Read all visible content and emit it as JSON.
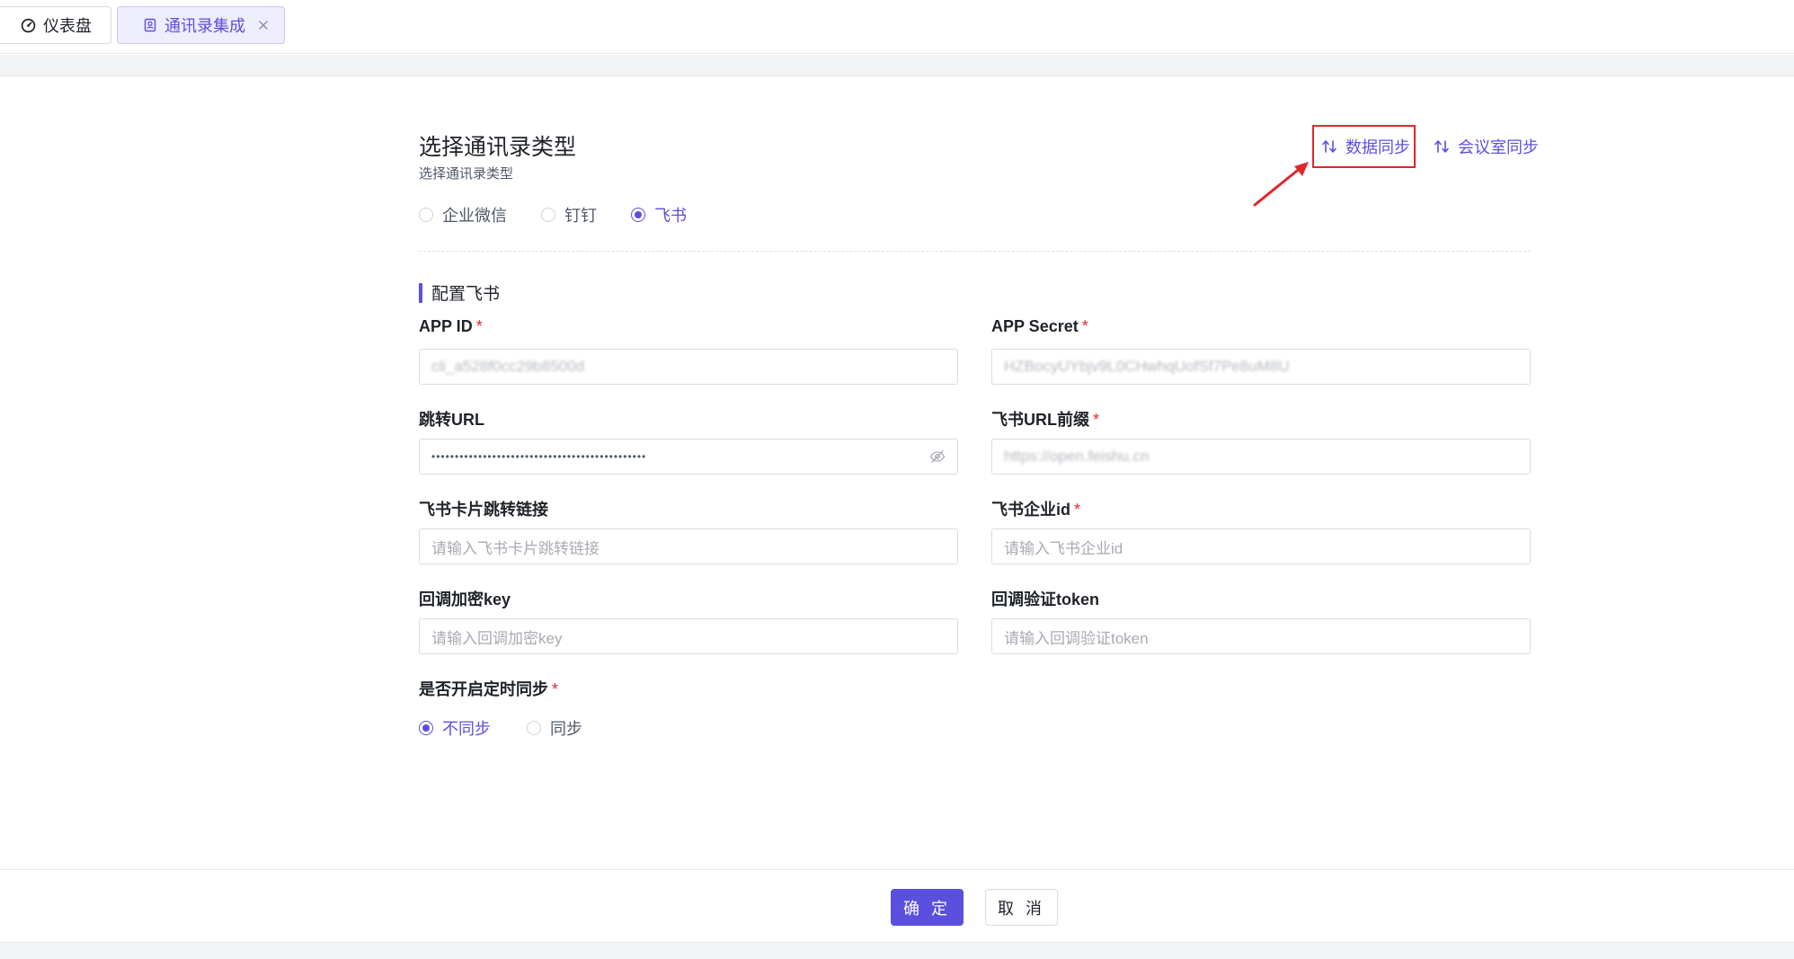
{
  "tabs": {
    "dashboard_label": "仪表盘",
    "contacts_label": "通讯录集成"
  },
  "header": {
    "title": "选择通讯录类型",
    "subtitle": "选择通讯录类型",
    "data_sync_label": "数据同步",
    "room_sync_label": "会议室同步"
  },
  "contact_types": {
    "selected": "飞书",
    "options": [
      "企业微信",
      "钉钉",
      "飞书"
    ]
  },
  "config": {
    "heading": "配置飞书",
    "app_id": {
      "label": "APP ID",
      "value": "cli_a528f0cc29b8500d"
    },
    "app_secret": {
      "label": "APP Secret",
      "value": "HZBocyUYbjv9L0CHwhqUofSf7Pe8uM8U"
    },
    "redirect_url": {
      "label": "跳转URL",
      "value": "••••••••••••••••••••••••••••••••••••••••••••••"
    },
    "feishu_url_prefix": {
      "label": "飞书URL前缀",
      "value": "https://open.feishu.cn"
    },
    "card_link": {
      "label": "飞书卡片跳转链接",
      "placeholder": "请输入飞书卡片跳转链接"
    },
    "enterprise_id": {
      "label": "飞书企业id",
      "placeholder": "请输入飞书企业id"
    },
    "callback_key": {
      "label": "回调加密key",
      "placeholder": "请输入回调加密key"
    },
    "callback_token": {
      "label": "回调验证token",
      "placeholder": "请输入回调验证token"
    },
    "scheduled_sync": {
      "label": "是否开启定时同步",
      "selected": "不同步",
      "options": [
        "不同步",
        "同步"
      ]
    }
  },
  "footer": {
    "confirm_label": "确 定",
    "cancel_label": "取 消"
  },
  "colors": {
    "accent": "#5b4fe0",
    "required": "#e0262d",
    "annotation": "#e0262d"
  }
}
